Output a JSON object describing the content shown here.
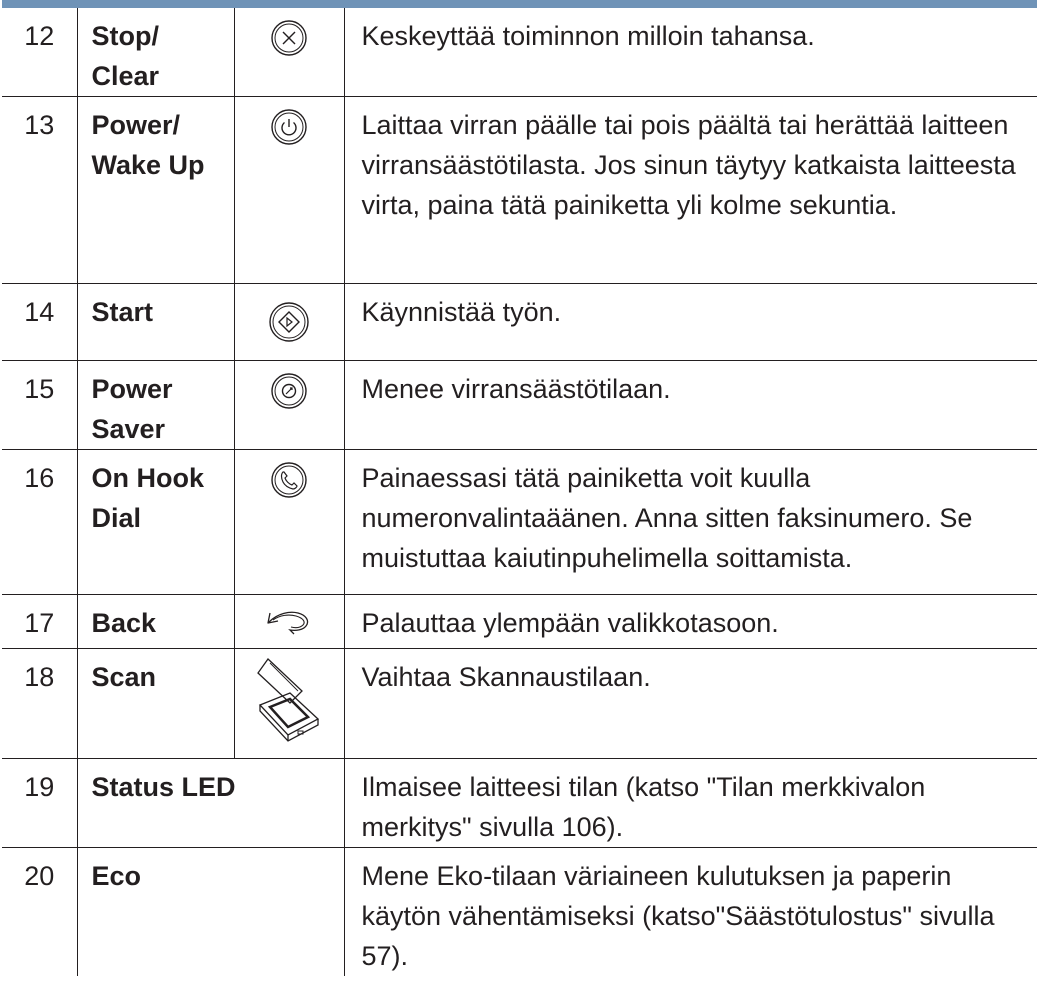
{
  "rows": [
    {
      "number": "12",
      "name_line1": "Stop/",
      "name_line2": "Clear",
      "icon": "stop-clear-icon",
      "description": "Keskeyttää toiminnon milloin tahansa."
    },
    {
      "number": "13",
      "name_line1": "Power/",
      "name_line2": "Wake Up",
      "icon": "power-icon",
      "description": "Laittaa virran päälle tai pois päältä tai herättää laitteen virransäästötilasta. Jos sinun täytyy katkaista laitteesta virta, paina tätä painiketta yli kolme sekuntia."
    },
    {
      "number": "14",
      "name_line1": "Start",
      "name_line2": "",
      "icon": "start-icon",
      "description": "Käynnistää työn."
    },
    {
      "number": "15",
      "name_line1": "Power",
      "name_line2": "Saver",
      "icon": "power-saver-icon",
      "description": "Menee virransäästötilaan."
    },
    {
      "number": "16",
      "name_line1": "On Hook",
      "name_line2": "Dial",
      "icon": "phone-icon",
      "description": "Painaessasi tätä painiketta voit kuulla numeronvalintaäänen. Anna sitten faksinumero. Se muistuttaa kaiutinpuhelimella soittamista."
    },
    {
      "number": "17",
      "name_line1": "Back",
      "name_line2": "",
      "icon": "back-arrow-icon",
      "description": "Palauttaa ylempään valikkotasoon."
    },
    {
      "number": "18",
      "name_line1": "Scan",
      "name_line2": "",
      "icon": "scanner-icon",
      "description": "Vaihtaa Skannaustilaan."
    },
    {
      "number": "19",
      "name_line1": "Status LED",
      "name_line2": "",
      "icon": "",
      "description": "Ilmaisee laitteesi tilan (katso \"Tilan merkkivalon merkitys\" sivulla 106)."
    },
    {
      "number": "20",
      "name_line1": "Eco",
      "name_line2": "",
      "icon": "",
      "description": "Mene Eko-tilaan väriaineen kulutuksen ja paperin käytön vähentämiseksi (katso\"Säästötulostus\" sivulla 57)."
    }
  ]
}
